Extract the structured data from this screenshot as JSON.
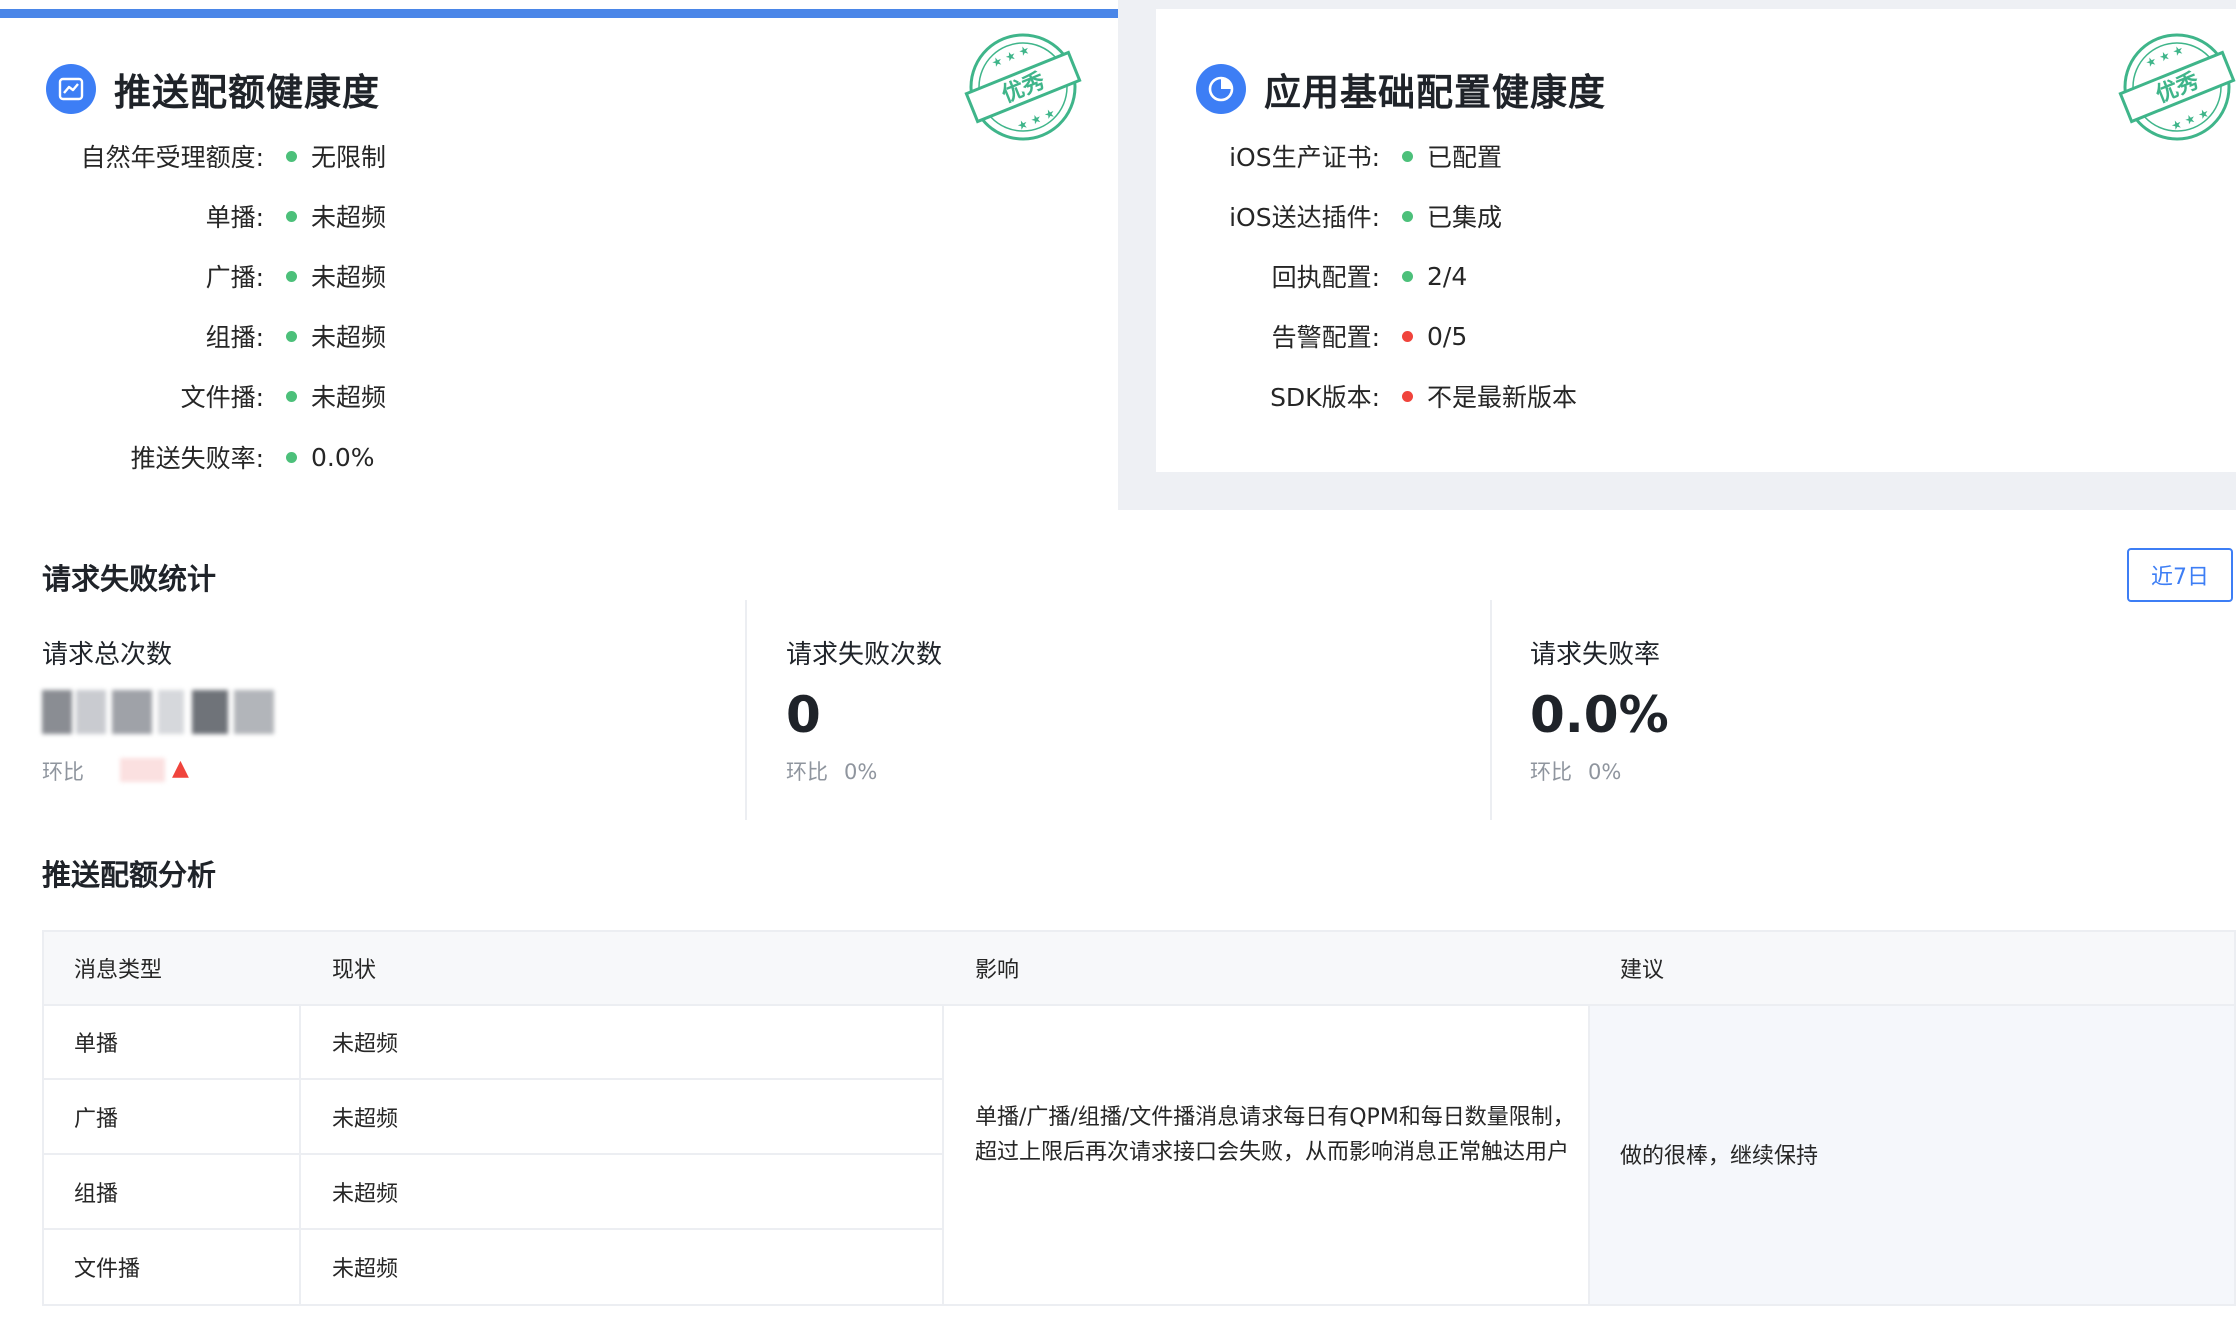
{
  "quota_card": {
    "title": "推送配额健康度",
    "stamp_text": "优秀",
    "rows": [
      {
        "label": "自然年受理额度:",
        "value": "无限制",
        "status": "green"
      },
      {
        "label": "单播:",
        "value": "未超频",
        "status": "green"
      },
      {
        "label": "广播:",
        "value": "未超频",
        "status": "green"
      },
      {
        "label": "组播:",
        "value": "未超频",
        "status": "green"
      },
      {
        "label": "文件播:",
        "value": "未超频",
        "status": "green"
      },
      {
        "label": "推送失败率:",
        "value": "0.0%",
        "status": "green"
      }
    ]
  },
  "config_card": {
    "title": "应用基础配置健康度",
    "stamp_text": "优秀",
    "rows": [
      {
        "label": "iOS生产证书:",
        "value": "已配置",
        "status": "green"
      },
      {
        "label": "iOS送达插件:",
        "value": "已集成",
        "status": "green"
      },
      {
        "label": "回执配置:",
        "value": "2/4",
        "status": "green"
      },
      {
        "label": "告警配置:",
        "value": "0/5",
        "status": "red"
      },
      {
        "label": "SDK版本:",
        "value": "不是最新版本",
        "status": "red"
      }
    ]
  },
  "fail_stats": {
    "title": "请求失败统计",
    "range_button": "近7日",
    "items": [
      {
        "label": "请求总次数",
        "value": "",
        "compare_label": "环比",
        "compare_value": ""
      },
      {
        "label": "请求失败次数",
        "value": "0",
        "compare_label": "环比",
        "compare_value": "0%"
      },
      {
        "label": "请求失败率",
        "value": "0.0%",
        "compare_label": "环比",
        "compare_value": "0%"
      }
    ]
  },
  "quota_analysis": {
    "title": "推送配额分析",
    "headers": [
      "消息类型",
      "现状",
      "影响",
      "建议"
    ],
    "rows": [
      {
        "type": "单播",
        "status": "未超频"
      },
      {
        "type": "广播",
        "status": "未超频"
      },
      {
        "type": "组播",
        "status": "未超频"
      },
      {
        "type": "文件播",
        "status": "未超频"
      }
    ],
    "impact": "单播/广播/组播/文件播消息请求每日有QPM和每日数量限制，超过上限后再次请求接口会失败，从而影响消息正常触达用户",
    "advice": "做的很棒，继续保持"
  },
  "colors": {
    "accent": "#3d7ef5",
    "ok": "#4cc07a",
    "bad": "#f0443c",
    "stamp": "#3fb58a"
  }
}
